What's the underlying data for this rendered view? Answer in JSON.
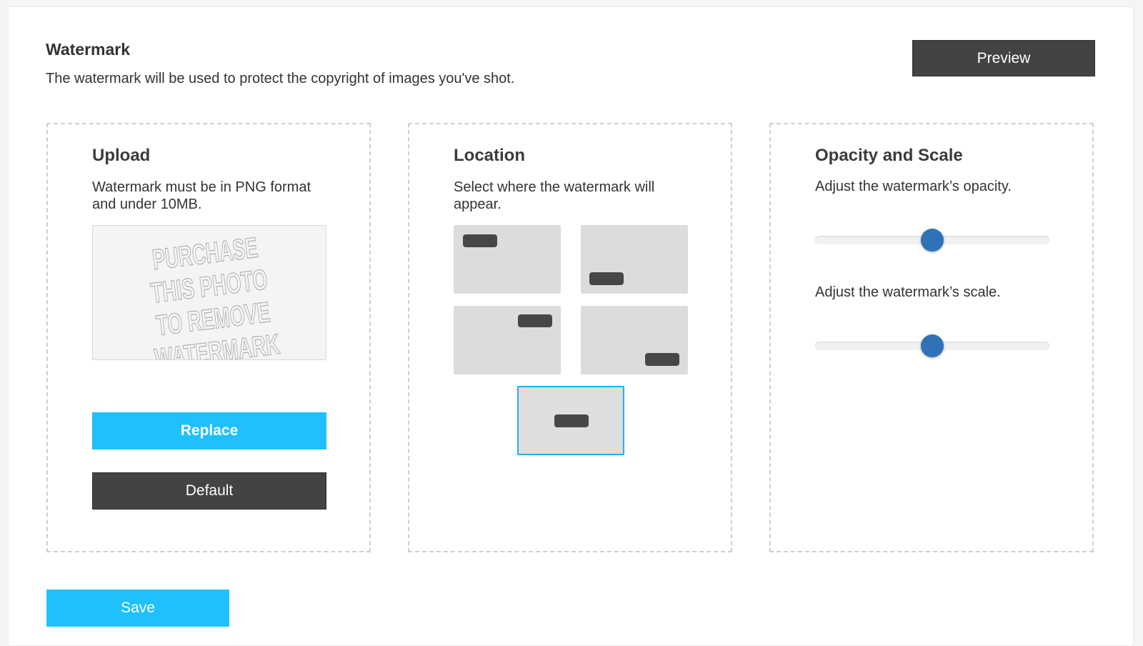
{
  "header": {
    "title": "Watermark",
    "description": "The watermark will be used to protect the copyright of images you've shot.",
    "preview_label": "Preview"
  },
  "upload": {
    "title": "Upload",
    "description": "Watermark must be in PNG format and under 10MB.",
    "watermark_lines": [
      "PURCHASE",
      "THIS PHOTO",
      "TO REMOVE",
      "WATERMARK"
    ],
    "replace_label": "Replace",
    "default_label": "Default"
  },
  "location": {
    "title": "Location",
    "description": "Select where the watermark will appear.",
    "positions": [
      "top-left",
      "bottom-left",
      "top-right",
      "bottom-right",
      "center"
    ],
    "selected": "center"
  },
  "opacity_scale": {
    "title": "Opacity and Scale",
    "opacity_label": "Adjust the watermark’s opacity.",
    "scale_label": "Adjust the watermark’s scale.",
    "opacity_value": 0.5,
    "scale_value": 0.5
  },
  "footer": {
    "save_label": "Save"
  },
  "colors": {
    "accent": "#1fc0fb",
    "dark_button": "#434343",
    "slider_thumb": "#2f72b8",
    "selected_border": "#1fb0f0"
  }
}
